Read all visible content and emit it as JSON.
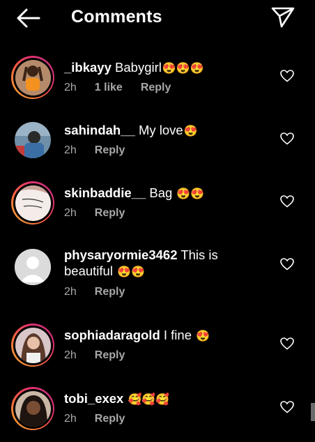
{
  "header": {
    "title": "Comments"
  },
  "icons": {
    "back": "arrow-left-icon",
    "send": "paper-plane-icon",
    "like": "heart-outline-icon"
  },
  "comments": [
    {
      "username": "_ibkayy",
      "text": "Babygirl",
      "emoji": "😍😍😍",
      "time": "2h",
      "likes": "1 like",
      "reply": "Reply",
      "ring": true
    },
    {
      "username": "sahindah__",
      "text": "My love",
      "emoji": "😍",
      "time": "2h",
      "reply": "Reply",
      "ring": false
    },
    {
      "username": "skinbaddie__",
      "text": "Bag",
      "emoji": "😍😍",
      "time": "2h",
      "reply": "Reply",
      "ring": true
    },
    {
      "username": "physaryormie3462",
      "text": "This is beautiful",
      "emoji": "😍😍",
      "time": "2h",
      "reply": "Reply",
      "ring": false
    },
    {
      "username": "sophiadaragold",
      "text": "I fine",
      "emoji": "😍",
      "time": "2h",
      "reply": "Reply",
      "ring": true
    },
    {
      "username": "tobi_exex",
      "text": "",
      "emoji": "🥰🥰🥰",
      "time": "2h",
      "reply": "Reply",
      "ring": true
    }
  ],
  "colors": {
    "background": "#000000",
    "text": "#ffffff",
    "meta": "#a8a8a8"
  }
}
